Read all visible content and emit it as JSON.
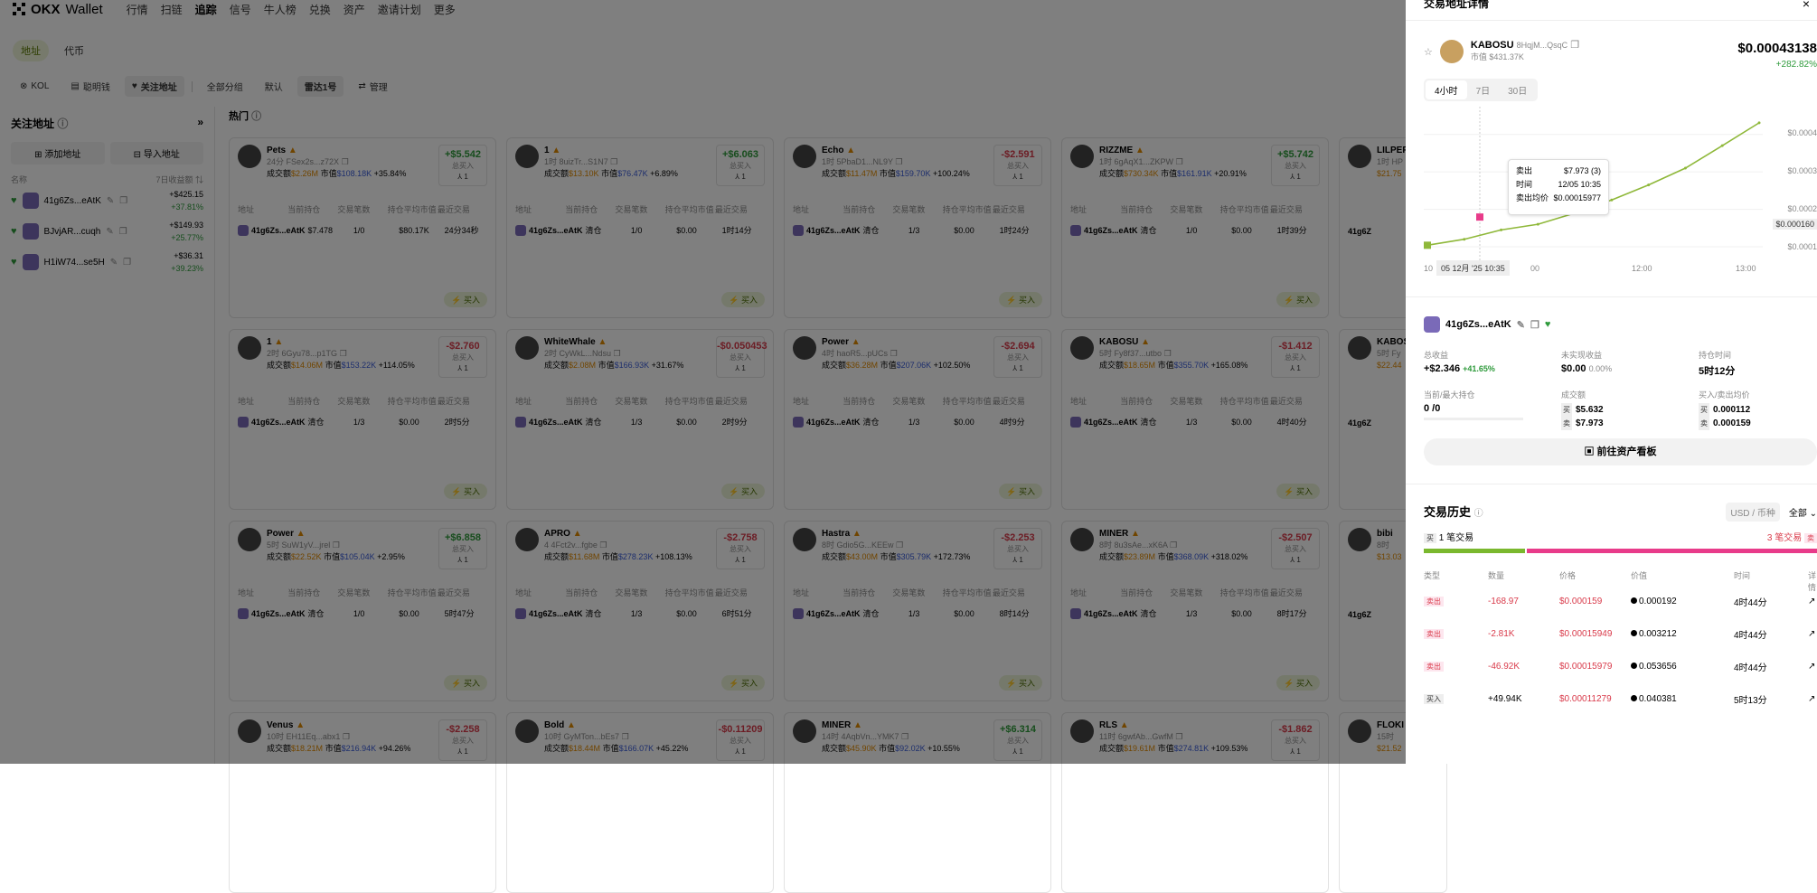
{
  "nav": {
    "brand": "Wallet",
    "menu": [
      "行情",
      "扫链",
      "追踪",
      "信号",
      "牛人榜",
      "兑换",
      "资产",
      "邀请计划",
      "更多"
    ],
    "active": "追踪"
  },
  "tabs": [
    "地址",
    "代币"
  ],
  "filters": [
    "KOL",
    "聪明钱",
    "关注地址",
    "全部分组",
    "默认",
    "雷达1号",
    "管理"
  ],
  "sidebar": {
    "title": "关注地址",
    "add_button": "添加地址",
    "import_button": "导入地址",
    "col_name": "名称",
    "col_pnl": "7日收益额",
    "items": [
      {
        "name": "41g6Zs...eAtK",
        "pnl": "+$425.15",
        "pct": "+37.81%"
      },
      {
        "name": "BJvjAR...cuqh",
        "pnl": "+$149.93",
        "pct": "+25.77%"
      },
      {
        "name": "H1iW74...se5H",
        "pnl": "+$36.31",
        "pct": "+39.23%"
      }
    ]
  },
  "hot_title": "热门",
  "table_headers": [
    "地址",
    "当前持仓",
    "交易笔数",
    "持仓平均市值",
    "最近交易"
  ],
  "buy_label": "买入",
  "buyers_label": "总买入",
  "cards": [
    {
      "name": "Pets",
      "sub": "24分 FSex2s...z72X",
      "vol": "$2.26M",
      "mc": "$108.18K",
      "chg": "+35.84%",
      "pnl": "+$5.542",
      "cnt": "1",
      "row": [
        "41g6Zs...eAtK",
        "$7.478",
        "1/0",
        "$80.17K",
        "24分34秒"
      ]
    },
    {
      "name": "1",
      "sub": "1时 8uizTr...S1N7",
      "vol": "$13.10K",
      "mc": "$76.47K",
      "chg": "+6.89%",
      "pnl": "+$6.063",
      "cnt": "1",
      "row": [
        "41g6Zs...eAtK",
        "清仓",
        "1/0",
        "$0.00",
        "1时14分"
      ]
    },
    {
      "name": "Echo",
      "sub": "1时 5PbaD1...NL9Y",
      "vol": "$11.47M",
      "mc": "$159.70K",
      "chg": "+100.24%",
      "pnl": "-$2.591",
      "cnt": "1",
      "row": [
        "41g6Zs...eAtK",
        "清仓",
        "1/3",
        "$0.00",
        "1时24分"
      ]
    },
    {
      "name": "RIZZME",
      "sub": "1时 6gAqX1...ZKPW",
      "vol": "$730.34K",
      "mc": "$161.91K",
      "chg": "+20.91%",
      "pnl": "+$5.742",
      "cnt": "1",
      "row": [
        "41g6Zs...eAtK",
        "清仓",
        "1/0",
        "$0.00",
        "1时39分"
      ]
    },
    {
      "name": "1",
      "sub": "2时 6Gyu78...p1TG",
      "vol": "$14.06M",
      "mc": "$153.22K",
      "chg": "+114.05%",
      "pnl": "-$2.760",
      "cnt": "1",
      "row": [
        "41g6Zs...eAtK",
        "清仓",
        "1/3",
        "$0.00",
        "2时5分"
      ]
    },
    {
      "name": "WhiteWhale",
      "sub": "2时 CyWkL...Ndsu",
      "vol": "$2.08M",
      "mc": "$166.93K",
      "chg": "+31.67%",
      "pnl": "-$0.050453",
      "cnt": "1",
      "row": [
        "41g6Zs...eAtK",
        "清仓",
        "1/3",
        "$0.00",
        "2时9分"
      ]
    },
    {
      "name": "Power",
      "sub": "4时 haoR5...pUCs",
      "vol": "$36.28M",
      "mc": "$207.06K",
      "chg": "+102.50%",
      "pnl": "-$2.694",
      "cnt": "1",
      "row": [
        "41g6Zs...eAtK",
        "清仓",
        "1/3",
        "$0.00",
        "4时9分"
      ]
    },
    {
      "name": "KABOSU",
      "sub": "5时 Fy8f37...utbo",
      "vol": "$18.65M",
      "mc": "$355.70K",
      "chg": "+165.08%",
      "pnl": "-$1.412",
      "cnt": "1",
      "row": [
        "41g6Zs...eAtK",
        "清仓",
        "1/3",
        "$0.00",
        "4时40分"
      ]
    },
    {
      "name": "Power",
      "sub": "5时 SuW1yV...jrel",
      "vol": "$22.52K",
      "mc": "$105.04K",
      "chg": "+2.95%",
      "pnl": "+$6.858",
      "cnt": "1",
      "row": [
        "41g6Zs...eAtK",
        "清仓",
        "1/0",
        "$0.00",
        "5时47分"
      ]
    },
    {
      "name": "APRO",
      "sub": "4 4Fct2v...fgbe",
      "vol": "$11.68M",
      "mc": "$278.23K",
      "chg": "+108.13%",
      "pnl": "-$2.758",
      "cnt": "1",
      "row": [
        "41g6Zs...eAtK",
        "清仓",
        "1/3",
        "$0.00",
        "6时51分"
      ]
    },
    {
      "name": "Hastra",
      "sub": "8时 Gdio5G...KEEw",
      "vol": "$43.00M",
      "mc": "$305.79K",
      "chg": "+172.73%",
      "pnl": "-$2.253",
      "cnt": "1",
      "row": [
        "41g6Zs...eAtK",
        "清仓",
        "1/3",
        "$0.00",
        "8时14分"
      ]
    },
    {
      "name": "MINER",
      "sub": "8时 8u3sAe...xK6A",
      "vol": "$23.89M",
      "mc": "$368.09K",
      "chg": "+318.02%",
      "pnl": "-$2.507",
      "cnt": "1",
      "row": [
        "41g6Zs...eAtK",
        "清仓",
        "1/3",
        "$0.00",
        "8时17分"
      ]
    },
    {
      "name": "Venus",
      "sub": "10时 EH11Eq...abx1",
      "vol": "$18.21M",
      "mc": "$216.94K",
      "chg": "+94.26%",
      "pnl": "-$2.258",
      "cnt": "1",
      "row": []
    },
    {
      "name": "Bold",
      "sub": "10时 GyMTon...bEs7",
      "vol": "$18.44M",
      "mc": "$166.07K",
      "chg": "+45.22%",
      "pnl": "-$0.11209",
      "cnt": "1",
      "row": []
    },
    {
      "name": "MINER",
      "sub": "14时 4AqbVn...YMK7",
      "vol": "$45.90K",
      "mc": "$92.02K",
      "chg": "+10.55%",
      "pnl": "+$6.314",
      "cnt": "1",
      "row": []
    },
    {
      "name": "RLS",
      "sub": "11时 6gwfAb...GwfM",
      "vol": "$19.61M",
      "mc": "$274.81K",
      "chg": "+109.53%",
      "pnl": "-$1.862",
      "cnt": "1",
      "row": []
    }
  ],
  "partial_cards": [
    {
      "name": "LILPEP",
      "sub": "1时 HP",
      "vol": "$21.75",
      "row": "41g6Z"
    },
    {
      "name": "KABOS",
      "sub": "5时 Fy",
      "vol": "$22.44",
      "row": "41g6Z"
    },
    {
      "name": "bibi",
      "sub": "8时",
      "vol": "$13.03",
      "row": "41g6Z"
    },
    {
      "name": "FLOKI",
      "sub": "15时",
      "vol": "$21.52",
      "row": ""
    }
  ],
  "card_labels": {
    "vol": "成交额",
    "mc": "市值"
  },
  "panel": {
    "title": "交易地址详情",
    "close": "×",
    "token": "KABOSU",
    "token_addr": "8HqjM...QsqC",
    "token_mc": "市值 $431.37K",
    "price": "$0.00043138",
    "price_chg": "+282.82%",
    "timeframes": [
      "4小时",
      "7日",
      "30日"
    ],
    "tooltip": {
      "k1": "卖出",
      "v1": "$7.973 (3)",
      "k2": "时间",
      "v2": "12/05 10:35",
      "k3": "卖出均价",
      "v3": "$0.00015977"
    },
    "x_labels": [
      "10",
      "05 12月 '25 10:35",
      "00",
      "12:00",
      "13:00"
    ],
    "y_labels": [
      "$0.0004",
      "$0.0003",
      "$0.0002",
      "$0.000160",
      "$0.0001"
    ],
    "wallet": "41g6Zs...eAtK",
    "stats": [
      {
        "label": "总收益",
        "value": "+$2.346",
        "extra": "+41.65%"
      },
      {
        "label": "未实现收益",
        "value": "$0.00",
        "extra": "0.00%"
      },
      {
        "label": "持仓时间",
        "value": "5时12分",
        "extra": ""
      },
      {
        "label": "当前/最大持仓",
        "value": "0 /0",
        "extra": ""
      }
    ],
    "volume_label": "成交额",
    "volume_buy": "$5.632",
    "volume_sell": "$7.973",
    "avg_label": "买入/卖出均价",
    "avg_buy": "0.000112",
    "avg_sell": "0.000159",
    "buy_tag": "买",
    "sell_tag": "卖",
    "dashboard_button": "前往资产看板",
    "history_title": "交易历史",
    "unit_toggle": "USD / 币种",
    "filter_all": "全部",
    "buy_count": "1 笔交易",
    "sell_count": "3 笔交易",
    "history_cols": [
      "类型",
      "数量",
      "价格",
      "价值",
      "时间",
      "详情"
    ],
    "history": [
      {
        "type": "卖出",
        "qty": "-168.97",
        "price": "$0.000159",
        "value": "0.000192",
        "time": "4时44分"
      },
      {
        "type": "卖出",
        "qty": "-2.81K",
        "price": "$0.00015949",
        "value": "0.003212",
        "time": "4时44分"
      },
      {
        "type": "卖出",
        "qty": "-46.92K",
        "price": "$0.00015979",
        "value": "0.053656",
        "time": "4时44分"
      },
      {
        "type": "买入",
        "qty": "+49.94K",
        "price": "$0.00011279",
        "value": "0.040381",
        "time": "5时13分"
      }
    ]
  },
  "chart_data": {
    "type": "line",
    "x": [
      "09:10",
      "09:40",
      "10:10",
      "10:35",
      "11:00",
      "11:30",
      "12:00",
      "12:30",
      "13:00",
      "13:20"
    ],
    "values": [
      0.000104,
      0.00012,
      0.000145,
      0.00016,
      0.00019,
      0.000225,
      0.000265,
      0.00031,
      0.00037,
      0.000431
    ],
    "ylim": [
      0.0001,
      0.00045
    ],
    "y_ticks": [
      "$0.0001",
      "$0.0002",
      "$0.0003",
      "$0.0004"
    ],
    "x_ticks": [
      "12:00",
      "13:00"
    ],
    "color": "#8fb83a"
  }
}
